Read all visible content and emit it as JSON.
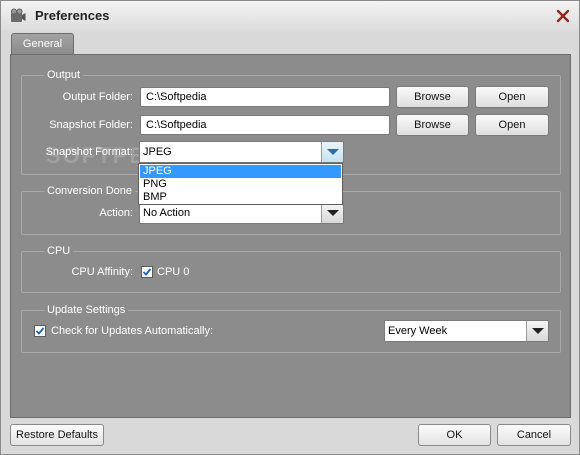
{
  "window": {
    "title": "Preferences",
    "app_icon": "film-reel-icon",
    "close_icon": "close-icon"
  },
  "tabs": [
    {
      "label": "General"
    }
  ],
  "output": {
    "group_label": "Output",
    "output_folder_label": "Output Folder:",
    "output_folder_value": "C:\\Softpedia",
    "snapshot_folder_label": "Snapshot Folder:",
    "snapshot_folder_value": "C:\\Softpedia",
    "browse_label": "Browse",
    "open_label": "Open",
    "snapshot_format_label": "Snapshot Format:",
    "snapshot_format_value": "JPEG",
    "snapshot_format_options": [
      "JPEG",
      "PNG",
      "BMP"
    ]
  },
  "conversion_done": {
    "group_label": "Conversion Done",
    "action_label": "Action:",
    "action_value": "No Action"
  },
  "cpu": {
    "group_label": "CPU",
    "affinity_label": "CPU Affinity:",
    "cpu0_label": "CPU 0",
    "cpu0_checked": true
  },
  "update_settings": {
    "group_label": "Update Settings",
    "check_updates_label": "Check for Updates Automatically:",
    "check_updates_checked": true,
    "frequency_value": "Every Week"
  },
  "footer": {
    "restore_defaults_label": "Restore Defaults",
    "ok_label": "OK",
    "cancel_label": "Cancel"
  },
  "watermark": "SOFTPEDIA",
  "colors": {
    "panel_bg": "#8c8c8c",
    "selection": "#3399ff",
    "checkbox_check": "#1c64b4"
  }
}
